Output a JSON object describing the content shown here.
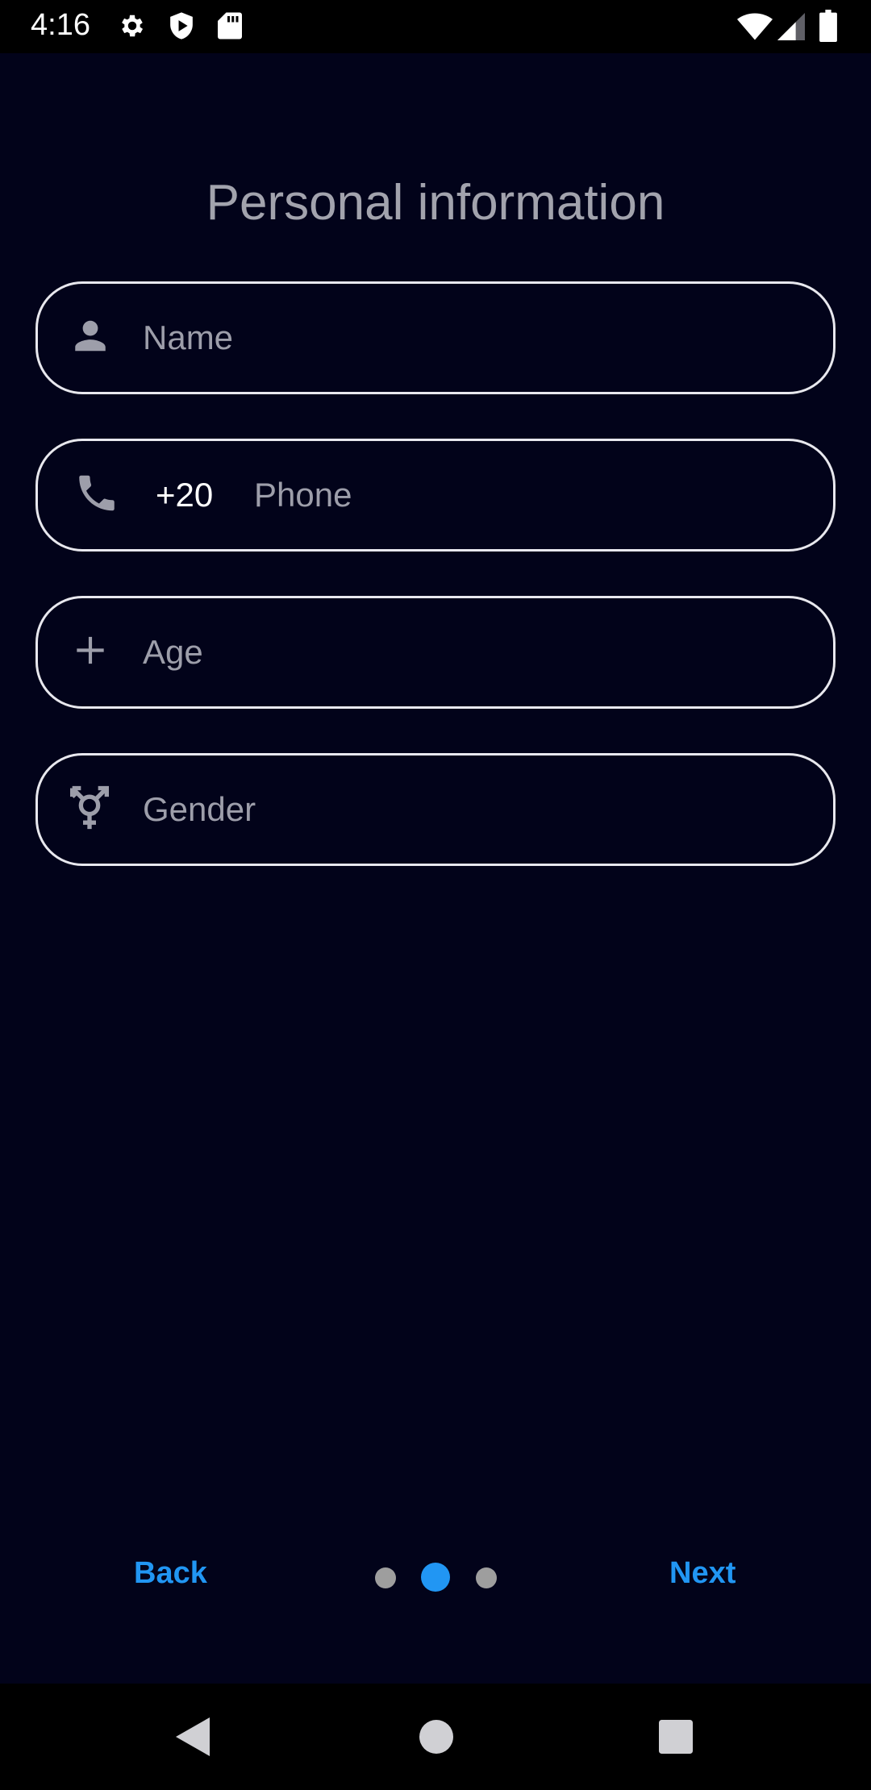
{
  "status_bar": {
    "time": "4:16",
    "icons": [
      "settings-icon",
      "shield-play-icon",
      "sd-card-icon",
      "wifi-icon",
      "cell-signal-icon",
      "battery-icon"
    ]
  },
  "page": {
    "title": "Personal information"
  },
  "form": {
    "name": {
      "icon": "person-icon",
      "placeholder": "Name"
    },
    "phone": {
      "icon": "phone-icon",
      "prefix": "+20",
      "placeholder": "Phone"
    },
    "age": {
      "icon": "plus-icon",
      "placeholder": "Age"
    },
    "gender": {
      "icon": "gender-icon",
      "placeholder": "Gender"
    }
  },
  "navigation": {
    "back_label": "Back",
    "next_label": "Next",
    "pager": {
      "total": 3,
      "current": 2
    }
  },
  "system_nav": {
    "icons": [
      "back-triangle-icon",
      "home-circle-icon",
      "recents-square-icon"
    ]
  },
  "colors": {
    "background": "#02031a",
    "accent": "#2196f3",
    "field_border": "#e8e8ee",
    "placeholder": "#9d9eaa",
    "title": "#a2a3ad",
    "dot_inactive": "#9e9e9e"
  }
}
